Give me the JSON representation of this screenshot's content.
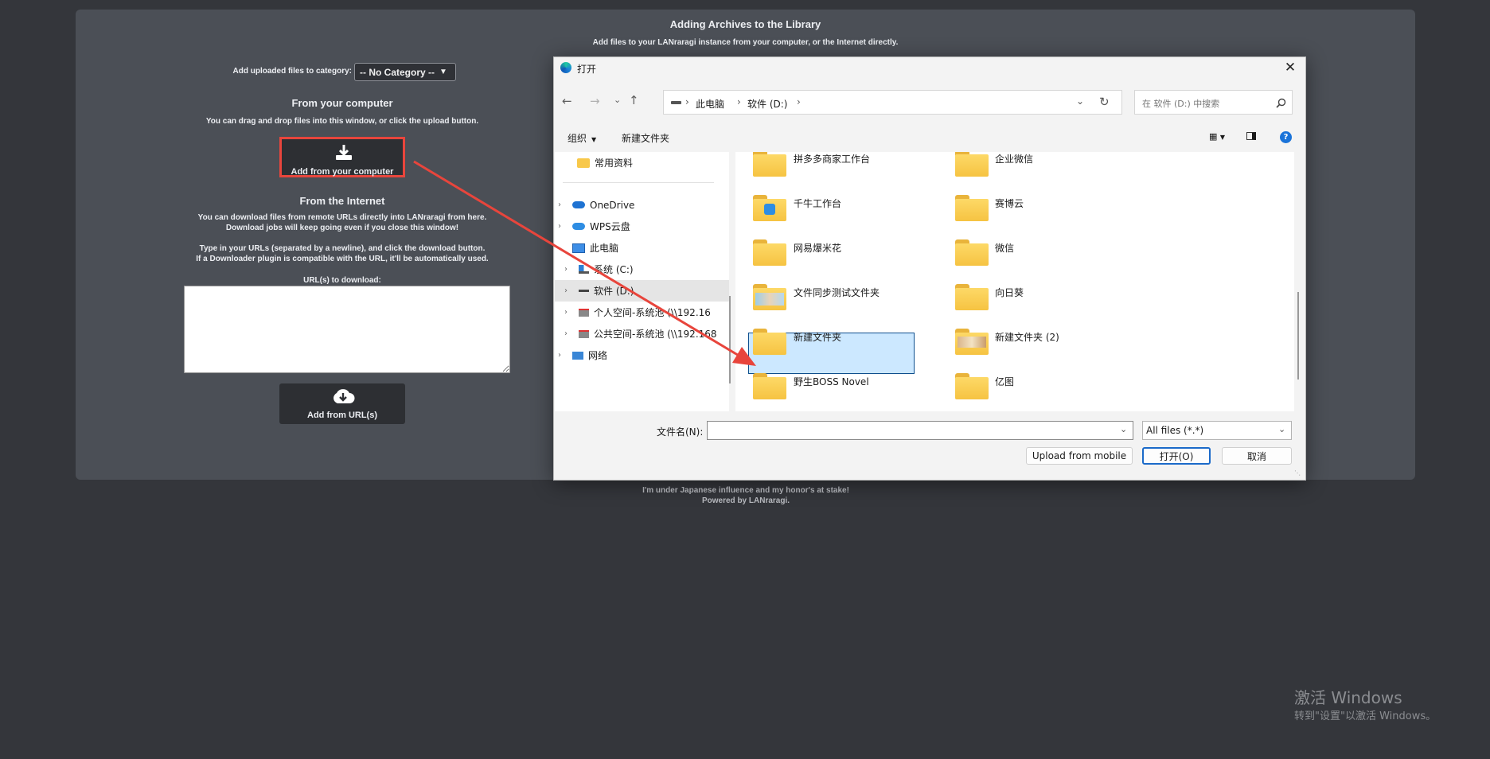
{
  "lanraragi": {
    "title": "Adding Archives to the Library",
    "subtitle": "Add files to your LANraragi instance from your computer, or the Internet directly.",
    "category_label": "Add uploaded files to category:",
    "category_value": "-- No Category --",
    "computer_heading": "From your computer",
    "computer_desc": "You can drag and drop files into this window, or click the upload button.",
    "computer_button": "Add from your computer",
    "internet_heading": "From the Internet",
    "internet_desc1": "You can download files from remote URLs directly into LANraragi from here.",
    "internet_desc2": "Download jobs will keep going even if you close this window!",
    "internet_desc3": "Type in your URLs (separated by a newline), and click the download button.",
    "internet_desc4": "If a Downloader plugin is compatible with the URL, it'll be automatically used.",
    "url_label": "URL(s) to download:",
    "url_button": "Add from URL(s)",
    "footer1": "I'm under Japanese influence and my honor's at stake!",
    "footer2": "Powered by LANraragi."
  },
  "dialog": {
    "title": "打开",
    "breadcrumb": [
      "此电脑",
      "软件 (D:)"
    ],
    "search_placeholder": "在 软件 (D:) 中搜索",
    "organize": "组织",
    "new_folder": "新建文件夹",
    "nav_items": [
      {
        "label": "常用资料",
        "icon": "folder-icon"
      },
      {
        "label": "OneDrive",
        "icon": "cloud-icon"
      },
      {
        "label": "WPS云盘",
        "icon": "cloud-icon"
      },
      {
        "label": "此电脑",
        "icon": "computer-icon"
      },
      {
        "label": "系统 (C:)",
        "icon": "drive-icon"
      },
      {
        "label": "软件 (D:)",
        "icon": "drive-icon"
      },
      {
        "label": "个人空间-系统池 (\\\\192.16",
        "icon": "network-drive-icon"
      },
      {
        "label": "公共空间-系统池 (\\\\192.168",
        "icon": "network-drive-icon"
      },
      {
        "label": "网络",
        "icon": "network-icon"
      }
    ],
    "folders": [
      "拼多多商家工作台",
      "企业微信",
      "千牛工作台",
      "赛博云",
      "网易爆米花",
      "微信",
      "文件同步测试文件夹",
      "向日葵",
      "新建文件夹",
      "新建文件夹 (2)",
      "野生BOSS Novel",
      "亿图"
    ],
    "selected_folder": "野生BOSS Novel",
    "filename_label": "文件名(N):",
    "filename_value": "",
    "filetype": "All files (*.*)",
    "upload_mobile": "Upload from mobile",
    "open_button": "打开(O)",
    "cancel_button": "取消"
  },
  "watermark": {
    "line1": "激活 Windows",
    "line2": "转到\"设置\"以激活 Windows。"
  },
  "colors": {
    "page_bg": "#34363b",
    "panel_bg": "#4b4f56",
    "highlight_red": "#e8453c",
    "folder_yellow": "#f6c342",
    "selection_blue": "#cce8ff"
  }
}
